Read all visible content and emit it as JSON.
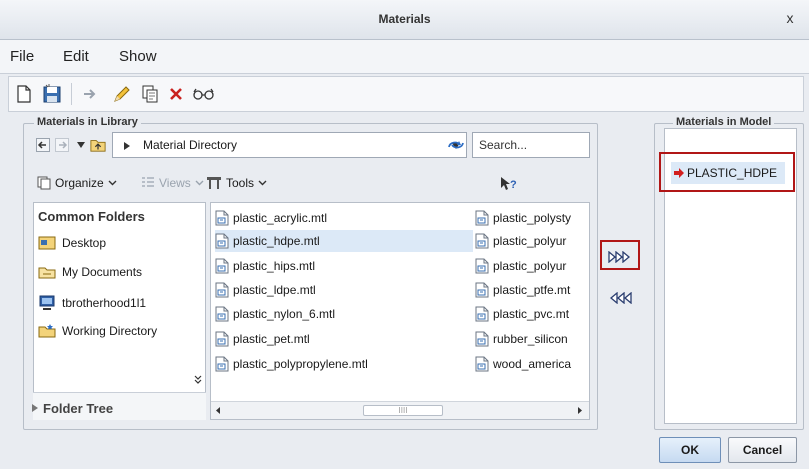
{
  "window": {
    "title": "Materials",
    "close_glyph": "x"
  },
  "menu": {
    "items": [
      "File",
      "Edit",
      "Show"
    ]
  },
  "toolbar": {
    "icons": [
      "new-icon",
      "save-icon",
      "arrow-right-icon",
      "pencil-icon",
      "copy-icon",
      "delete-icon",
      "glasses-icon"
    ]
  },
  "library": {
    "group_label": "Materials in Library",
    "path": "Material Directory",
    "search_placeholder": "Search...",
    "organize_label": "Organize",
    "views_label": "Views",
    "tools_label": "Tools",
    "common_folders_label": "Common Folders",
    "folders": [
      "Desktop",
      "My Documents",
      "tbrotherhood1l1",
      "Working Directory"
    ],
    "folder_tree_label": "Folder Tree",
    "files_col1": [
      "plastic_acrylic.mtl",
      "plastic_hdpe.mtl",
      "plastic_hips.mtl",
      "plastic_ldpe.mtl",
      "plastic_nylon_6.mtl",
      "plastic_pet.mtl",
      "plastic_polypropylene.mtl"
    ],
    "files_col2": [
      "plastic_polysty",
      "plastic_polyur",
      "plastic_polyur",
      "plastic_ptfe.mt",
      "plastic_pvc.mt",
      "rubber_silicon",
      "wood_america"
    ],
    "selected_file": "plastic_hdpe.mtl"
  },
  "model": {
    "group_label": "Materials in Model",
    "items": [
      "PLASTIC_HDPE"
    ]
  },
  "buttons": {
    "ok": "OK",
    "cancel": "Cancel"
  },
  "colors": {
    "highlight": "#dce9f7",
    "annotation_red": "#b11616",
    "accent_blue": "#2b3e70"
  }
}
